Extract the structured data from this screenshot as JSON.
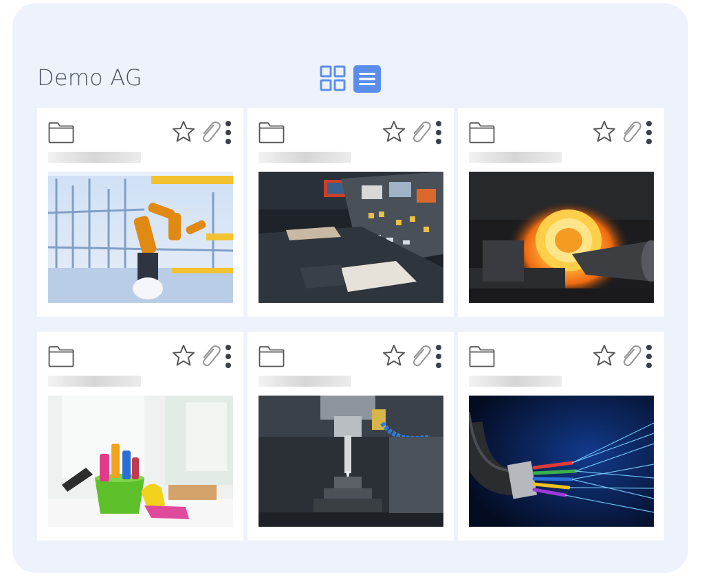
{
  "header": {
    "title": "Demo AG"
  },
  "view_toggle": {
    "active": "list",
    "accent_color": "#5b8def"
  },
  "cards": [
    {
      "thumbnail": "robotic-assembly-line-photo"
    },
    {
      "thumbnail": "control-panel-photo"
    },
    {
      "thumbnail": "hot-steel-coil-photo"
    },
    {
      "thumbnail": "cleaning-supplies-photo"
    },
    {
      "thumbnail": "cnc-milling-machine-photo"
    },
    {
      "thumbnail": "fiber-optic-cable-photo"
    }
  ]
}
